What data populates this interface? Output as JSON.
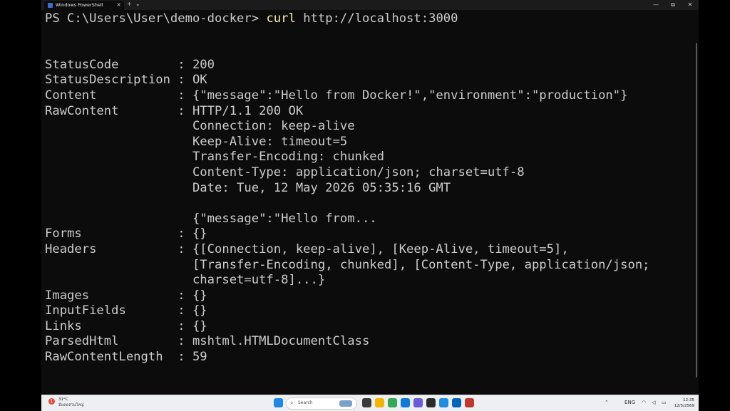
{
  "window": {
    "tab_title": "Windows PowerShell",
    "tab_close": "×",
    "new_tab": "+",
    "dropdown": "⌄",
    "minimize": "—",
    "maximize": "⧉",
    "close": "✕"
  },
  "terminal": {
    "prompt": "PS C:\\Users\\User\\demo-docker> ",
    "command": "curl",
    "argument": " http://localhost:3000",
    "output_lines": [
      "",
      "",
      "StatusCode        : 200",
      "StatusDescription : OK",
      "Content           : {\"message\":\"Hello from Docker!\",\"environment\":\"production\"}",
      "RawContent        : HTTP/1.1 200 OK",
      "                    Connection: keep-alive",
      "                    Keep-Alive: timeout=5",
      "                    Transfer-Encoding: chunked",
      "                    Content-Type: application/json; charset=utf-8",
      "                    Date: Tue, 12 May 2026 05:35:16 GMT",
      "",
      "                    {\"message\":\"Hello from...",
      "Forms             : {}",
      "Headers           : {[Connection, keep-alive], [Keep-Alive, timeout=5],",
      "                    [Transfer-Encoding, chunked], [Content-Type, application/json;",
      "                    charset=utf-8]...}",
      "Images            : {}",
      "InputFields       : {}",
      "Links             : {}",
      "ParsedHtml        : mshtml.HTMLDocumentClass",
      "RawContentLength  : 59"
    ]
  },
  "taskbar": {
    "weather_badge": "1",
    "weather_temp": "31°C",
    "weather_condition": "มีแดดส่วนใหญ่",
    "search_label": "Search",
    "tray_language": "ENG",
    "clock_time": "12:35",
    "clock_date": "12/5/2569",
    "apps": [
      {
        "name": "windows-start",
        "color": "#1e88e5"
      },
      {
        "name": "task-view",
        "color": "#3a3a3a"
      },
      {
        "name": "file-explorer",
        "color": "#f4b400"
      },
      {
        "name": "chrome",
        "color": "#34a853"
      },
      {
        "name": "edge",
        "color": "#0f7bd7"
      },
      {
        "name": "copilot",
        "color": "#6b5bd6"
      },
      {
        "name": "terminal",
        "color": "#2b2b2b"
      },
      {
        "name": "docker",
        "color": "#1d8fe1"
      },
      {
        "name": "vscode",
        "color": "#0066b8"
      },
      {
        "name": "app-extra",
        "color": "#c0392b"
      }
    ]
  }
}
